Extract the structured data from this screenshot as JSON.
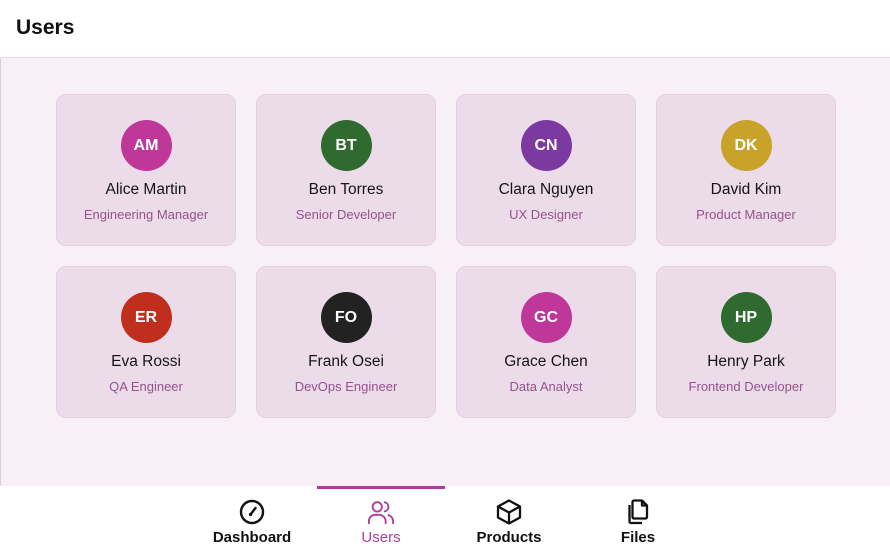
{
  "header": {
    "title": "Users"
  },
  "users": [
    {
      "initials": "AM",
      "name": "Alice Martin",
      "role": "Engineering Manager",
      "color": "#c0379a"
    },
    {
      "initials": "BT",
      "name": "Ben Torres",
      "role": "Senior Developer",
      "color": "#2f6a2e"
    },
    {
      "initials": "CN",
      "name": "Clara Nguyen",
      "role": "UX Designer",
      "color": "#7c3aa0"
    },
    {
      "initials": "DK",
      "name": "David Kim",
      "role": "Product Manager",
      "color": "#c9a22a"
    },
    {
      "initials": "ER",
      "name": "Eva Rossi",
      "role": "QA Engineer",
      "color": "#c02e1e"
    },
    {
      "initials": "FO",
      "name": "Frank Osei",
      "role": "DevOps Engineer",
      "color": "#222222"
    },
    {
      "initials": "GC",
      "name": "Grace Chen",
      "role": "Data Analyst",
      "color": "#c0379a"
    },
    {
      "initials": "HP",
      "name": "Henry Park",
      "role": "Frontend Developer",
      "color": "#2f6a2e"
    }
  ],
  "nav": {
    "dashboard": {
      "label": "Dashboard",
      "icon": "gauge-icon"
    },
    "users": {
      "label": "Users",
      "icon": "users-icon"
    },
    "products": {
      "label": "Products",
      "icon": "box-icon"
    },
    "files": {
      "label": "Files",
      "icon": "files-icon"
    }
  },
  "colors": {
    "accent": "#b03b9e",
    "content_bg": "#f8eff7",
    "card_bg": "#ecdcea",
    "role_text": "#95528d"
  }
}
